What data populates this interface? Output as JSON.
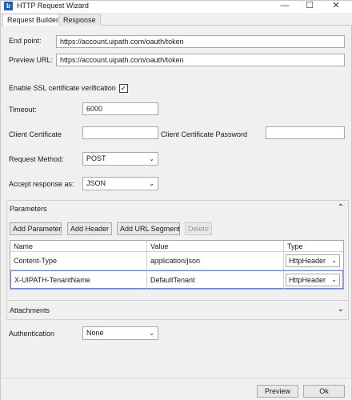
{
  "window": {
    "title": "HTTP Request Wizard",
    "icon_name": "uipath-app-icon",
    "controls": [
      "minimize-icon",
      "maximize-icon",
      "close-icon"
    ]
  },
  "tabs": [
    "Request Builder",
    "Response"
  ],
  "form": {
    "endpoint_label": "End point:",
    "endpoint_value": "https://account.uipath.com/oauth/token",
    "preview_label": "Preview URL:",
    "preview_value": "https://account.uipath.com/oauth/token",
    "ssl_label": "Enable SSL certificate verification",
    "ssl_checked": true,
    "timeout_label": "Timeout:",
    "timeout_value": "6000",
    "client_cert_label": "Client Certificate",
    "client_cert_value": "",
    "client_cert_pw_label": "Client Certificate Password",
    "client_cert_pw_value": "",
    "method_label": "Request Method:",
    "method_value": "POST",
    "accept_label": "Accept response as:",
    "accept_value": "JSON"
  },
  "parameters": {
    "title": "Parameters",
    "buttons": {
      "add_parameter": "Add Parameter",
      "add_header": "Add Header",
      "add_url_segment": "Add URL Segment",
      "delete": "Delete"
    },
    "columns": [
      "Name",
      "Value",
      "Type"
    ],
    "rows": [
      {
        "name": "Content-Type",
        "value": "application/json",
        "type": "HttpHeader"
      },
      {
        "name": "X-UIPATH-TenantName",
        "value": "DefaultTenant",
        "type": "HttpHeader"
      }
    ]
  },
  "attachments": {
    "title": "Attachments"
  },
  "authentication": {
    "label": "Authentication",
    "value": "None"
  },
  "footer": {
    "preview_label": "Preview",
    "ok_label": "Ok"
  }
}
